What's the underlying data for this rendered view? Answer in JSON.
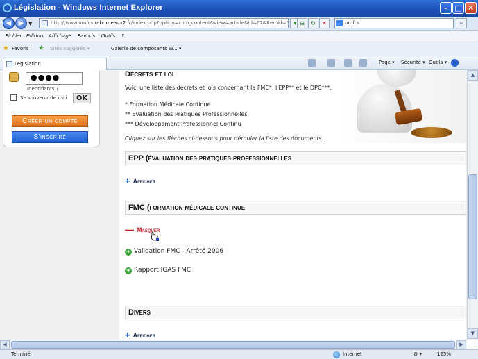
{
  "window": {
    "title": "Législation - Windows Internet Explorer"
  },
  "address": {
    "url_prefix": "http://www.umfcs.",
    "url_domain": "u-bordeaux2.fr",
    "url_path": "/index.php?option=com_content&view=article&id=67&Itemid=59",
    "search_value": "umfcs"
  },
  "menu": [
    "Fichier",
    "Edition",
    "Affichage",
    "Favoris",
    "Outils",
    "?"
  ],
  "favorites": {
    "label": "Favoris",
    "items": [
      "Sites suggérés ▾",
      "Galerie de composants W... ▾"
    ]
  },
  "tab": {
    "label": "Législation"
  },
  "commands": {
    "page": "Page ▾",
    "security": "Sécurité ▾",
    "tools": "Outils ▾"
  },
  "login": {
    "password_value": "●●●●",
    "ident_link": "Identifiants ?",
    "remember_label": "Se souvenir de moi",
    "ok_label": "OK",
    "create_label": "Créer un compte",
    "signup_label": "S'inscrire"
  },
  "content": {
    "heading": "Décrets et loi",
    "intro": "Voici une liste des décrets et lois concernant la FMC*, l'EPP** et le DPC***.",
    "abbr": [
      "* Formation Médicale Continue",
      "** Evaluation des Pratiques Professionnelles",
      "*** Développement Professionnel Continu"
    ],
    "note": "Cliquez sur les flèches ci-dessous pour dérouler la liste des documents.",
    "sections": [
      {
        "title": "EPP (évaluation des pratiques professionnelles",
        "toggle": "Afficher"
      },
      {
        "title": "FMC (formation médicale continue",
        "toggle": "Masquer",
        "docs": [
          "Validation FMC - Arrêté 2006",
          "Rapport IGAS FMC"
        ]
      },
      {
        "title": "Divers",
        "toggle": "Afficher"
      }
    ]
  },
  "status": {
    "text": "Terminé",
    "zone": "Internet",
    "zoom": "125%"
  },
  "colors": {
    "titlebar": "#1b4fb3",
    "create_button": "#e06a10",
    "signup_button": "#1d5fcf",
    "masquer": "#b8232a"
  }
}
